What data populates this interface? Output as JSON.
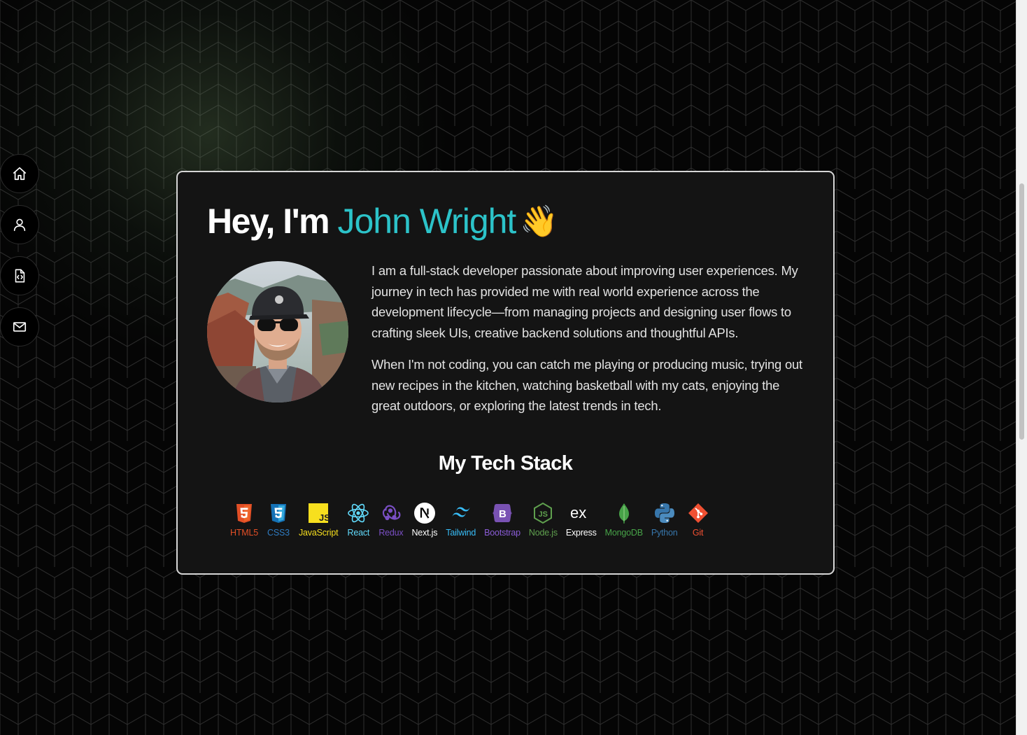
{
  "greeting": {
    "prefix": "Hey, I'm",
    "name": "John Wright",
    "emoji": "👋"
  },
  "bio": [
    "I am a full-stack developer passionate about improving user experiences. My journey in tech has provided me with real world experience across the development lifecycle—from managing projects and designing user flows to crafting sleek UIs, creative backend solutions and thoughtful APIs.",
    "When I'm not coding, you can catch me playing or producing music, trying out new recipes in the kitchen, watching basketball with my cats, enjoying the great outdoors, or exploring the latest trends in tech."
  ],
  "stack_title": "My Tech Stack",
  "tech_stack": [
    {
      "label": "HTML5",
      "icon": "html5-icon",
      "color": "#e34f26"
    },
    {
      "label": "CSS3",
      "icon": "css3-icon",
      "color": "#2f7bc1"
    },
    {
      "label": "JavaScript",
      "icon": "javascript-icon",
      "color": "#f7df1e"
    },
    {
      "label": "React",
      "icon": "react-icon",
      "color": "#61dafb"
    },
    {
      "label": "Redux",
      "icon": "redux-icon",
      "color": "#7a4fc4"
    },
    {
      "label": "Next.js",
      "icon": "nextjs-icon",
      "color": "#ffffff"
    },
    {
      "label": "Tailwind",
      "icon": "tailwind-icon",
      "color": "#38bdf8"
    },
    {
      "label": "Bootstrap",
      "icon": "bootstrap-icon",
      "color": "#8a5cd6"
    },
    {
      "label": "Node.js",
      "icon": "nodejs-icon",
      "color": "#5fa04e"
    },
    {
      "label": "Express",
      "icon": "express-icon",
      "color": "#ffffff"
    },
    {
      "label": "MongoDB",
      "icon": "mongodb-icon",
      "color": "#47a248"
    },
    {
      "label": "Python",
      "icon": "python-icon",
      "color": "#3776ab"
    },
    {
      "label": "Git",
      "icon": "git-icon",
      "color": "#f05032"
    }
  ],
  "nav": [
    {
      "icon": "home-icon"
    },
    {
      "icon": "user-icon"
    },
    {
      "icon": "code-file-icon"
    },
    {
      "icon": "mail-icon"
    }
  ],
  "colors": {
    "accent": "#2cc3c9",
    "card_bg": "#141414",
    "card_border": "#d6d6d6"
  }
}
